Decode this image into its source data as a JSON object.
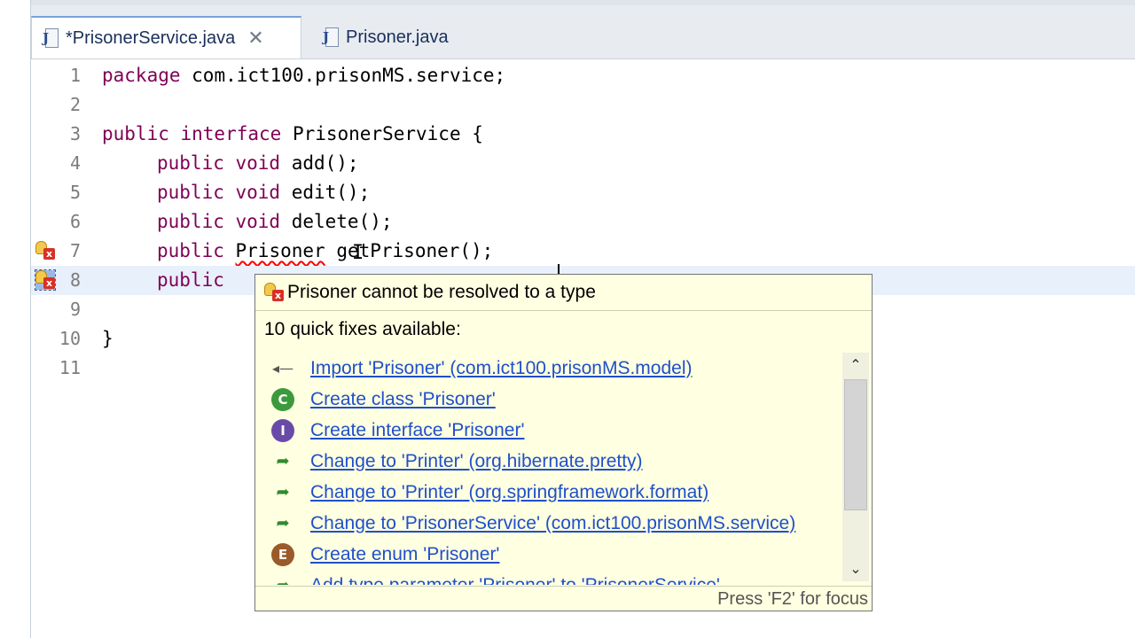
{
  "tabs": [
    {
      "label": "*PrisonerService.java",
      "active": true
    },
    {
      "label": "Prisoner.java",
      "active": false
    }
  ],
  "editor": {
    "lines": [
      {
        "num": "1"
      },
      {
        "num": "2"
      },
      {
        "num": "3"
      },
      {
        "num": "4"
      },
      {
        "num": "5"
      },
      {
        "num": "6"
      },
      {
        "num": "7"
      },
      {
        "num": "8"
      },
      {
        "num": "9"
      },
      {
        "num": "10"
      },
      {
        "num": "11"
      }
    ],
    "code": {
      "l1_kw": "package",
      "l1_rest": " com.ict100.prisonMS.service;",
      "l3_kw": "public interface",
      "l3_rest": " PrisonerService {",
      "l4_kw": "public void",
      "l4_rest": " add();",
      "l5_kw": "public void",
      "l5_rest": " edit();",
      "l6_kw": "public void",
      "l6_rest": " delete();",
      "l7_kw": "public",
      "l7_err": "Prisoner",
      "l7_rest": " getPrisoner();",
      "l8_kw": "public",
      "l10": "}"
    }
  },
  "quickfix": {
    "title": "Prisoner cannot be resolved to a type",
    "count_text": "10 quick fixes available:",
    "fixes": [
      {
        "label": "Import 'Prisoner' (com.ict100.prisonMS.model)",
        "icon": "import-icon"
      },
      {
        "label": "Create class 'Prisoner'",
        "icon": "class-icon"
      },
      {
        "label": "Create interface 'Prisoner'",
        "icon": "interface-icon"
      },
      {
        "label": "Change to 'Printer' (org.hibernate.pretty)",
        "icon": "change-icon"
      },
      {
        "label": "Change to 'Printer' (org.springframework.format)",
        "icon": "change-icon"
      },
      {
        "label": "Change to 'PrisonerService' (com.ict100.prisonMS.service)",
        "icon": "change-icon"
      },
      {
        "label": "Create enum 'Prisoner'",
        "icon": "enum-icon"
      },
      {
        "label": "Add type parameter 'Prisoner' to 'PrisonerService'",
        "icon": "change-icon"
      }
    ],
    "footer": "Press 'F2' for focus",
    "icons": {
      "class": "C",
      "interface": "I",
      "enum": "E",
      "import": "◂—",
      "change": "➦",
      "error": "x"
    }
  },
  "colors": {
    "keyword": "#7f0055",
    "link": "#1f4fcc",
    "popup_bg": "#ffffe1",
    "error": "#d93025"
  }
}
